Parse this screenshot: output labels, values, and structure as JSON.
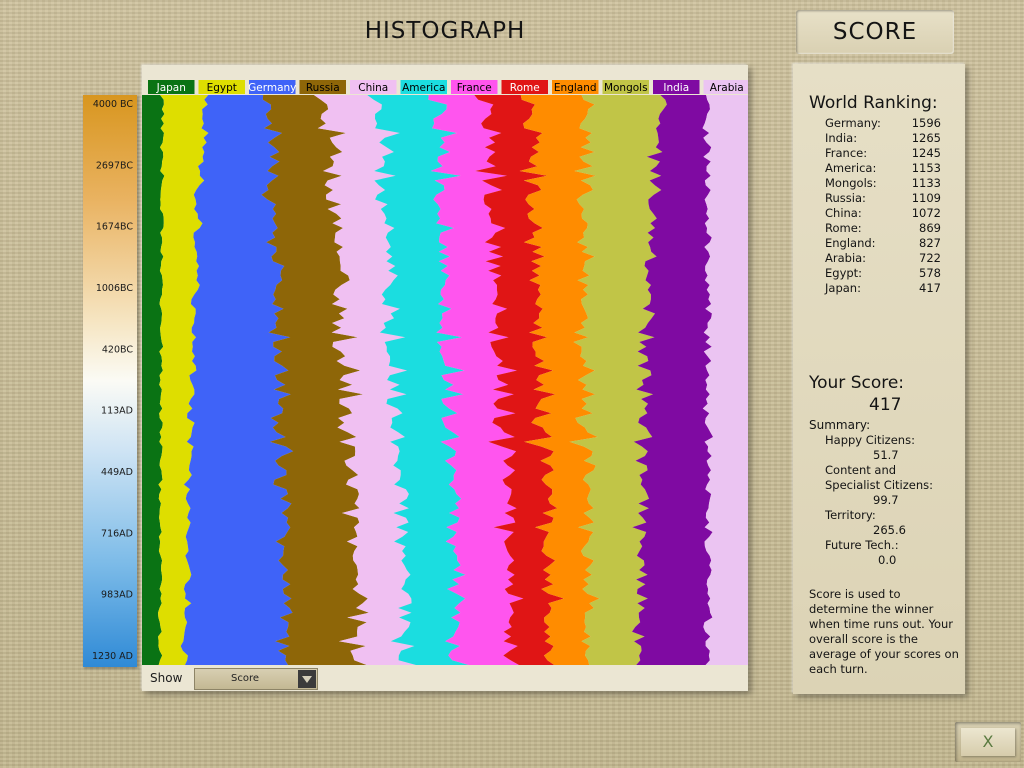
{
  "header": {
    "title": "HISTOGRAPH",
    "score_tab": "SCORE"
  },
  "timeline": [
    "4000 BC",
    "2697BC",
    "1674BC",
    "1006BC",
    "420BC",
    "113AD",
    "449AD",
    "716AD",
    "983AD",
    "1230 AD"
  ],
  "show": {
    "label": "Show",
    "value": "Score"
  },
  "world_ranking": {
    "title": "World Ranking:",
    "entries": [
      {
        "name": "Germany:",
        "value": "1596"
      },
      {
        "name": "India:",
        "value": "1265"
      },
      {
        "name": "France:",
        "value": "1245"
      },
      {
        "name": "America:",
        "value": "1153"
      },
      {
        "name": "Mongols:",
        "value": "1133"
      },
      {
        "name": "Russia:",
        "value": "1109"
      },
      {
        "name": "China:",
        "value": "1072"
      },
      {
        "name": "Rome:",
        "value": "869"
      },
      {
        "name": "England:",
        "value": "827"
      },
      {
        "name": "Arabia:",
        "value": "722"
      },
      {
        "name": "Egypt:",
        "value": "578"
      },
      {
        "name": "Japan:",
        "value": "417"
      }
    ]
  },
  "your_score": {
    "title": "Your Score:",
    "value": "417",
    "summary_title": "Summary:",
    "happy_label": "Happy Citizens:",
    "happy_value": "51.7",
    "content_label_1": "Content and",
    "content_label_2": "Specialist Citizens:",
    "content_value": "99.7",
    "territory_label": "Territory:",
    "territory_value": "265.6",
    "future_label": "Future Tech.:",
    "future_value": "0.0"
  },
  "note": "Score is used to determine the winner when time runs out. Your overall score is the average of your scores on each turn.",
  "close_label": "X",
  "chart_data": {
    "type": "area",
    "stacked": true,
    "normalized": true,
    "orientation": "vertical",
    "time_axis": [
      "4000 BC",
      "2697BC",
      "1674BC",
      "1006BC",
      "420BC",
      "113AD",
      "449AD",
      "716AD",
      "983AD",
      "1230 AD"
    ],
    "series": [
      {
        "name": "Japan",
        "color": "#0a7314",
        "share_start": 3,
        "share_end": 2.7
      },
      {
        "name": "Egypt",
        "color": "#dede00",
        "share_start": 6.5,
        "share_end": 3.7
      },
      {
        "name": "Germany",
        "color": "#3f63f8",
        "share_start": 8.5,
        "share_end": 15.3
      },
      {
        "name": "Russia",
        "color": "#8e6608",
        "share_start": 8.0,
        "share_end": 10.7
      },
      {
        "name": "China",
        "color": "#f0c0f2",
        "share_start": 7.5,
        "share_end": 7.0
      },
      {
        "name": "America",
        "color": "#1bdde0",
        "share_start": 9.0,
        "share_end": 7.5
      },
      {
        "name": "France",
        "color": "#ff55ee",
        "share_start": 7.0,
        "share_end": 8.1
      },
      {
        "name": "Rome",
        "color": "#e01515",
        "share_start": 6.5,
        "share_end": 5.6
      },
      {
        "name": "England",
        "color": "#ff8c00",
        "share_start": 8.5,
        "share_end": 5.6
      },
      {
        "name": "Mongols",
        "color": "#c1c547",
        "share_start": 11.5,
        "share_end": 7.5
      },
      {
        "name": "India",
        "color": "#7f0aa2",
        "share_start": 6.5,
        "share_end": 10.6
      },
      {
        "name": "Arabia",
        "color": "#ebc4f2",
        "share_start": 6.0,
        "share_end": 5.9
      }
    ]
  }
}
